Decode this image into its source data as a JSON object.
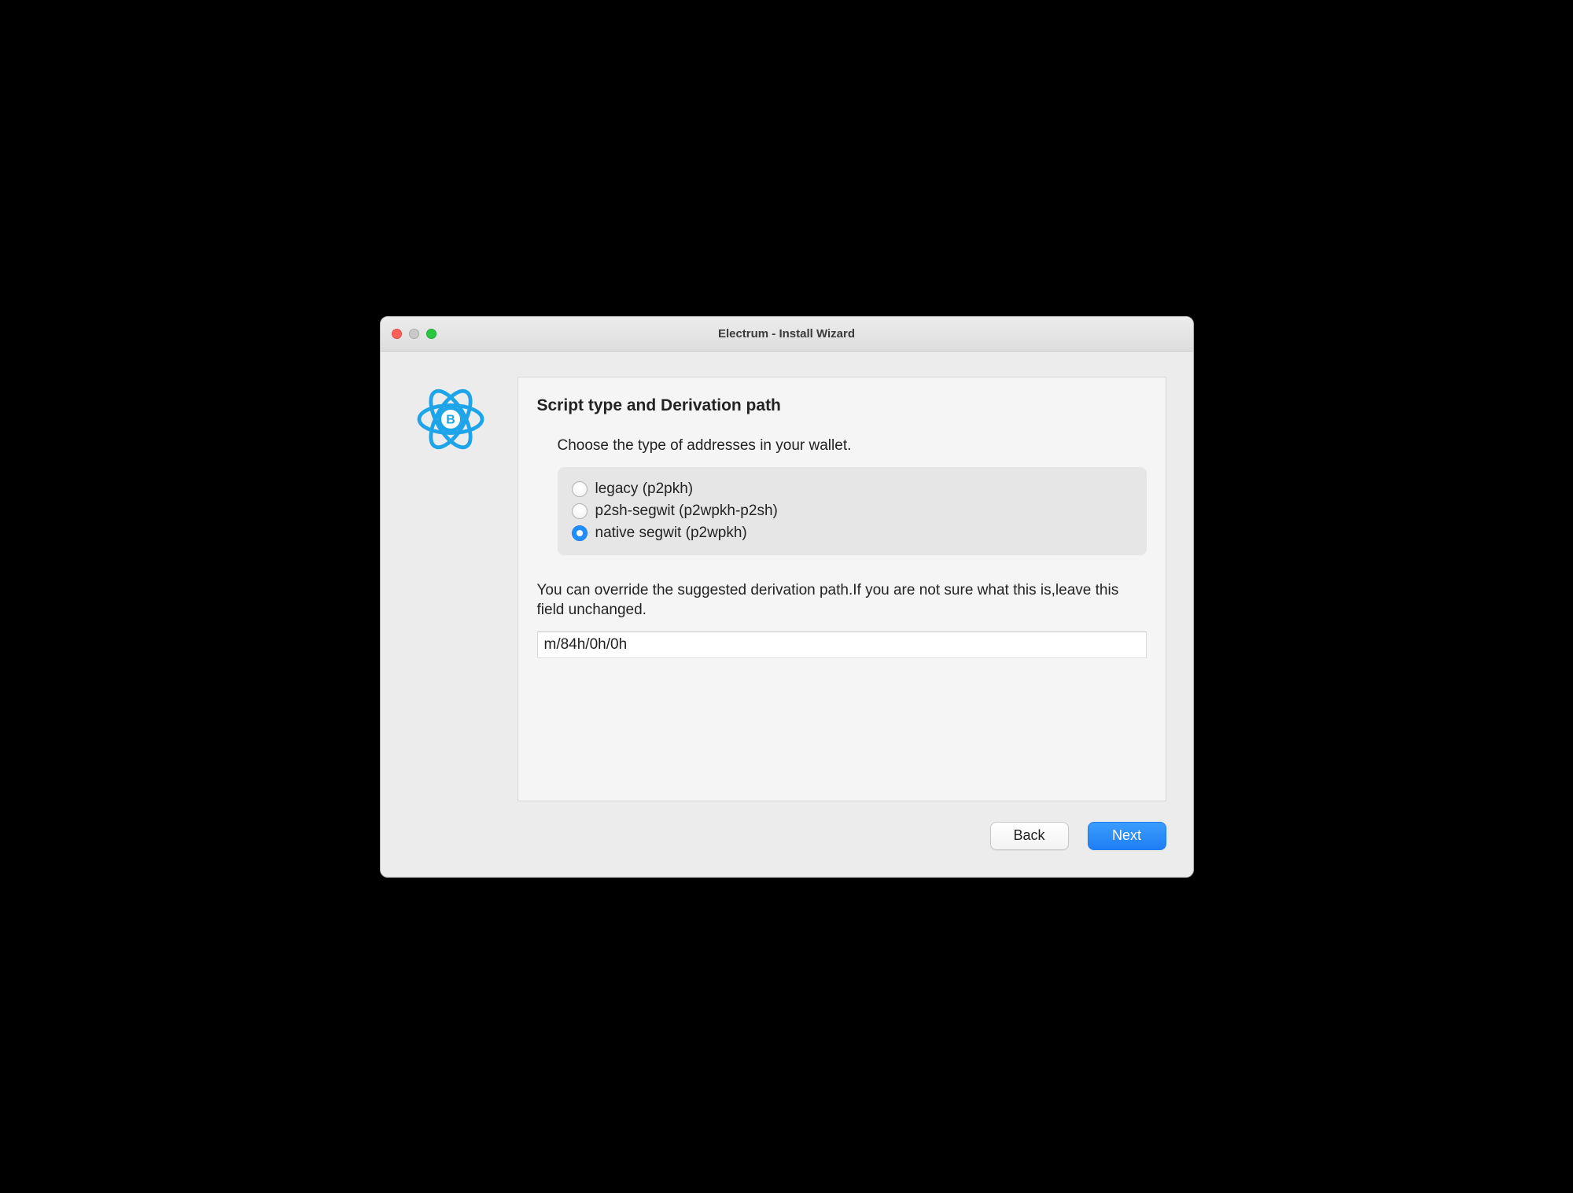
{
  "window": {
    "title": "Electrum  -  Install Wizard"
  },
  "wizard": {
    "heading": "Script type and Derivation path",
    "instruction": "Choose the type of addresses in your wallet.",
    "options": [
      {
        "id": "legacy",
        "label": "legacy (p2pkh)",
        "selected": false
      },
      {
        "id": "p2sh-segwit",
        "label": "p2sh-segwit (p2wpkh-p2sh)",
        "selected": false
      },
      {
        "id": "native-segwit",
        "label": "native segwit (p2wpkh)",
        "selected": true
      }
    ],
    "hint": "You can override the suggested derivation path.If you are not sure what this is,leave this field unchanged.",
    "derivation_path": "m/84h/0h/0h"
  },
  "footer": {
    "back_label": "Back",
    "next_label": "Next"
  }
}
